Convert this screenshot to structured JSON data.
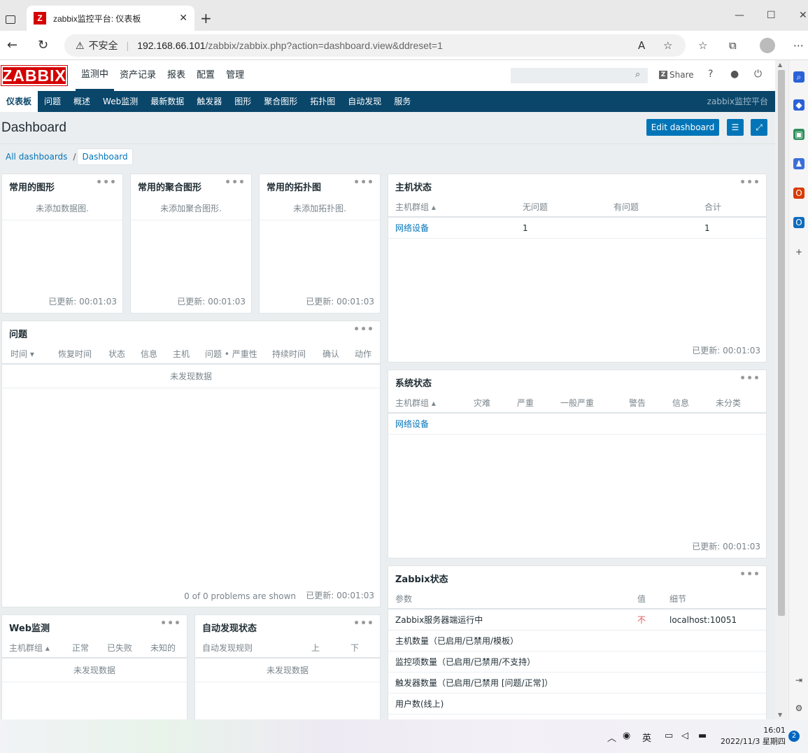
{
  "browser": {
    "tab_title": "zabbix监控平台: 仪表板",
    "url_insecure": "不安全",
    "url_host": "192.168.66.101",
    "url_path": "/zabbix/zabbix.php?action=dashboard.view&ddreset=1"
  },
  "topnav": {
    "logo": "ZABBIX",
    "items": [
      {
        "label": "监测中"
      },
      {
        "label": "资产记录"
      },
      {
        "label": "报表"
      },
      {
        "label": "配置"
      },
      {
        "label": "管理"
      }
    ],
    "share": "Share"
  },
  "subnav": {
    "items": [
      {
        "label": "仪表板"
      },
      {
        "label": "问题"
      },
      {
        "label": "概述"
      },
      {
        "label": "Web监测"
      },
      {
        "label": "最新数据"
      },
      {
        "label": "触发器"
      },
      {
        "label": "图形"
      },
      {
        "label": "聚合图形"
      },
      {
        "label": "拓扑图"
      },
      {
        "label": "自动发现"
      },
      {
        "label": "服务"
      }
    ],
    "brand": "zabbix监控平台"
  },
  "page": {
    "title": "Dashboard",
    "edit_button": "Edit dashboard",
    "breadcrumb_all": "All dashboards",
    "breadcrumb_current": "Dashboard"
  },
  "updated": "已更新: 00:01:03",
  "widgets": {
    "fav_graphs": {
      "title": "常用的图形",
      "message": "未添加数据图."
    },
    "fav_screens": {
      "title": "常用的聚合图形",
      "message": "未添加聚合图形."
    },
    "fav_maps": {
      "title": "常用的拓扑图",
      "message": "未添加拓扑图."
    },
    "problems": {
      "title": "问题",
      "columns": [
        "时间 ▾",
        "恢复时间",
        "状态",
        "信息",
        "主机",
        "问题 • 严重性",
        "持续时间",
        "确认",
        "动作"
      ],
      "empty": "未发现数据",
      "footer": "0 of 0 problems are shown"
    },
    "host_status": {
      "title": "主机状态",
      "columns": [
        "主机群组 ▴",
        "无问题",
        "有问题",
        "合计"
      ],
      "rows": [
        [
          "网络设备",
          "1",
          "",
          "1"
        ]
      ]
    },
    "system_status": {
      "title": "系统状态",
      "columns": [
        "主机群组 ▴",
        "灾难",
        "严重",
        "一般严重",
        "警告",
        "信息",
        "未分类"
      ],
      "rows": [
        [
          "网络设备"
        ]
      ]
    },
    "web": {
      "title": "Web监测",
      "columns": [
        "主机群组 ▴",
        "正常",
        "已失败",
        "未知的"
      ],
      "empty": "未发现数据"
    },
    "discovery": {
      "title": "自动发现状态",
      "columns": [
        "自动发现规则",
        "上",
        "下"
      ],
      "empty": "未发现数据"
    },
    "zabbix_status": {
      "title": "Zabbix状态",
      "columns": [
        "参数",
        "值",
        "细节"
      ],
      "rows": [
        [
          "Zabbix服务器端运行中",
          "不",
          "localhost:10051"
        ],
        [
          "主机数量（已启用/已禁用/模板）",
          "",
          ""
        ],
        [
          "监控项数量（已启用/已禁用/不支持）",
          "",
          ""
        ],
        [
          "触发器数量（已启用/已禁用 [问题/正常]）",
          "",
          ""
        ],
        [
          "用户数(线上)",
          "",
          ""
        ]
      ]
    }
  },
  "taskbar": {
    "ime": "英",
    "time": "16:01",
    "date": "2022/11/3 星期四",
    "notifications": "2"
  }
}
